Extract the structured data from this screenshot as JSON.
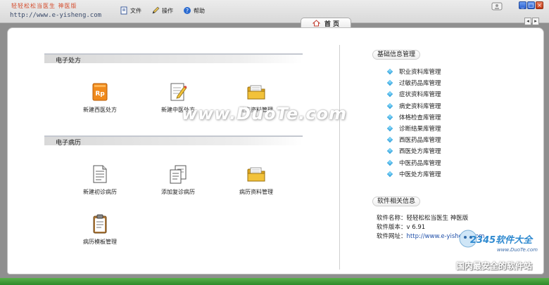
{
  "brand": {
    "logo_text": "轻轻松松当医生 神医版",
    "url": "http://www.e-yisheng.com"
  },
  "menu": [
    {
      "label": "文件",
      "icon": "document-icon"
    },
    {
      "label": "操作",
      "icon": "pencil-icon"
    },
    {
      "label": "帮助",
      "icon": "help-icon"
    }
  ],
  "tab": {
    "label": "首 页",
    "icon": "home-icon"
  },
  "sections": {
    "prescription": {
      "title": "电子处方",
      "tiles": [
        {
          "label": "新建西医处方",
          "icon": "rp-prescription-icon"
        },
        {
          "label": "新建中医处方",
          "icon": "edit-document-icon"
        },
        {
          "label": "处方资料管理",
          "icon": "folder-icon"
        }
      ]
    },
    "records": {
      "title": "电子病历",
      "tiles": [
        {
          "label": "新建初诊病历",
          "icon": "new-record-icon"
        },
        {
          "label": "添加复诊病历",
          "icon": "copy-record-icon"
        },
        {
          "label": "病历资料管理",
          "icon": "folder-icon"
        },
        {
          "label": "病历模板管理",
          "icon": "clipboard-icon"
        }
      ]
    }
  },
  "basic_info": {
    "title": "基础信息管理",
    "links": [
      "职业资料库管理",
      "过敏药品库管理",
      "症状资料库管理",
      "病史资料库管理",
      "体格检查库管理",
      "诊断结果库管理",
      "西医药品库管理",
      "西医处方库管理",
      "中医药品库管理",
      "中医处方库管理"
    ]
  },
  "software_info": {
    "title": "软件相关信息",
    "name_label": "软件名称：",
    "name_value": "轻轻松松当医生 神医版",
    "version_label": "软件版本：",
    "version_value": "v 6.91",
    "url_label": "软件网址：",
    "url_value": "http://www.e-yisheng.com"
  },
  "watermarks": {
    "duote": "www.DuoTe.com",
    "brand2345": "2345软件大全",
    "brand2345_url": "www.DuoTe.com",
    "slogan": "国内最安全的软件站"
  },
  "colors": {
    "accent_blue": "#1b8fd0",
    "folder_yellow": "#f2c23a",
    "rp_orange": "#f08a1c",
    "url_blue": "#1f4fa8"
  }
}
